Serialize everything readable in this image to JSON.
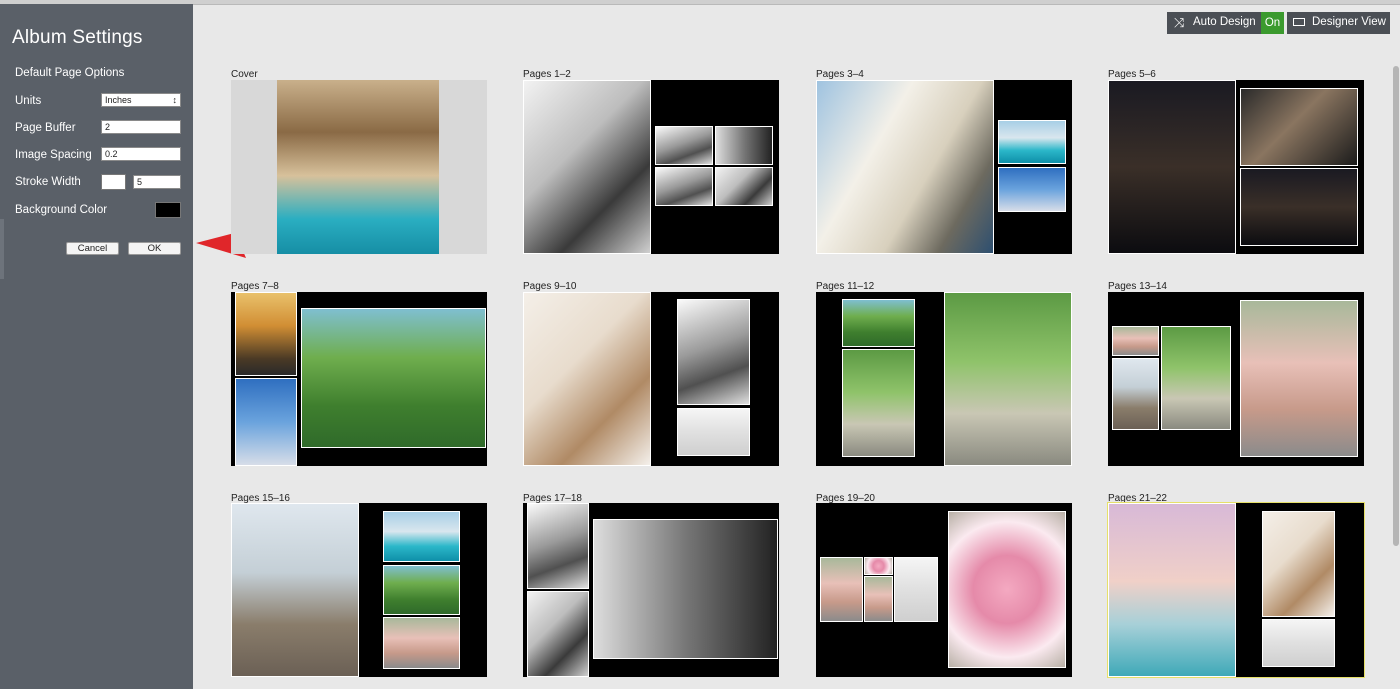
{
  "sidebar": {
    "title": "Album Settings",
    "section": "Default Page Options",
    "units": {
      "label": "Units",
      "value": "Inches"
    },
    "page_buffer": {
      "label": "Page Buffer",
      "value": "2"
    },
    "image_spacing": {
      "label": "Image Spacing",
      "value": "0.2"
    },
    "stroke_width": {
      "label": "Stroke Width",
      "value": "5",
      "color": "#ffffff"
    },
    "background_color": {
      "label": "Background Color",
      "color": "#000000"
    },
    "cancel_label": "Cancel",
    "ok_label": "OK"
  },
  "toolbar": {
    "auto_design_label": "Auto Design",
    "auto_design_state": "On",
    "designer_view_label": "Designer View"
  },
  "annotation": {
    "arrow_color": "#e0262a"
  },
  "spreads": [
    {
      "label": "Cover"
    },
    {
      "label": "Pages 1–2"
    },
    {
      "label": "Pages 3–4"
    },
    {
      "label": "Pages 5–6"
    },
    {
      "label": "Pages 7–8"
    },
    {
      "label": "Pages 9–10"
    },
    {
      "label": "Pages 11–12"
    },
    {
      "label": "Pages 13–14"
    },
    {
      "label": "Pages 15–16"
    },
    {
      "label": "Pages 17–18"
    },
    {
      "label": "Pages 19–20"
    },
    {
      "label": "Pages 21–22"
    }
  ]
}
